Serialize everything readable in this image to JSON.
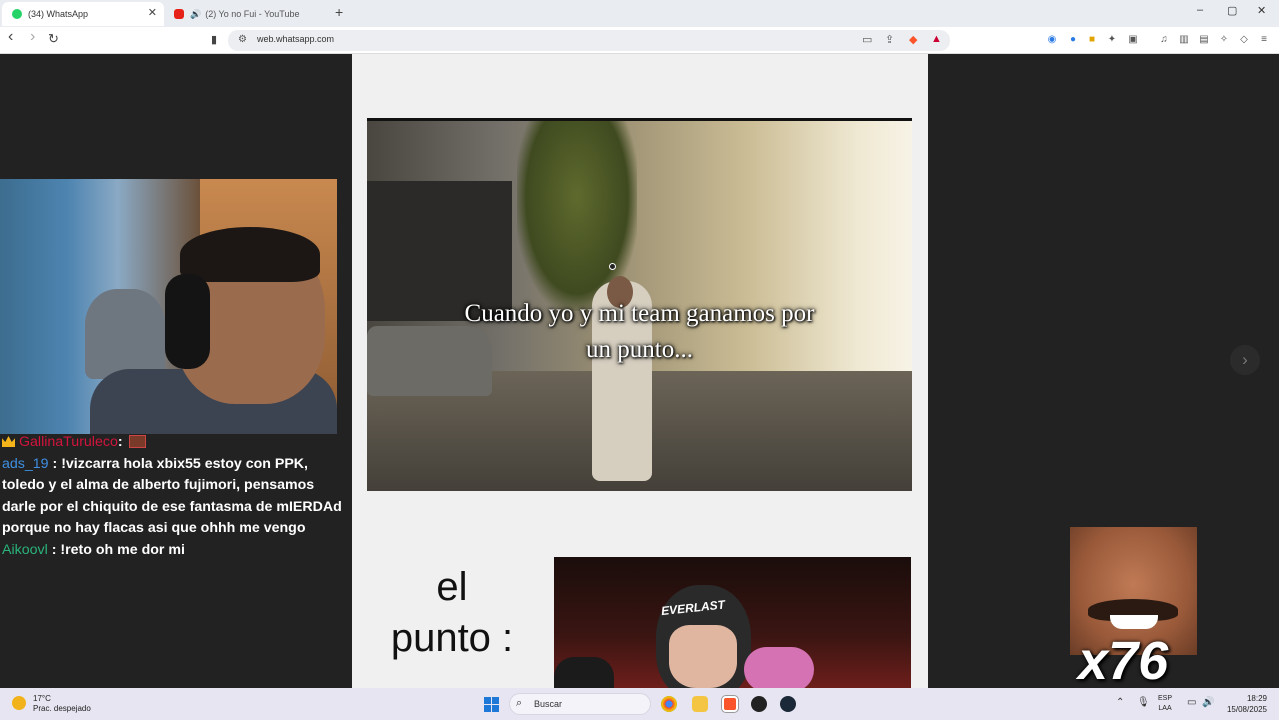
{
  "browser": {
    "tabs": [
      {
        "title": "(34) WhatsApp",
        "favicon": "whatsapp-icon",
        "active": true
      },
      {
        "title": "(2) Yo no Fui - YouTube",
        "favicon": "youtube-icon",
        "audio": "speaker-icon",
        "active": false
      }
    ],
    "new_tab": "+",
    "window_controls": {
      "minimize": "–",
      "restore": "▢",
      "close": "✕"
    },
    "nav": {
      "back": "‹",
      "forward": "›",
      "reload": "↻"
    },
    "url": "web.whatsapp.com"
  },
  "stream": {
    "chat": [
      {
        "user": "GallinaTuruleco",
        "color": "#d2143c",
        "badge": "crown-badge",
        "text": "",
        "emote": true
      },
      {
        "user": "ads_19",
        "color": "#3f8fe3",
        "text": "!vizcarra hola xbix55 estoy con PPK, toledo y el alma de alberto fujimori, pensamos darle por el chiquito de ese fantasma de mIERDAd porque no hay flacas asi que ohhh me vengo"
      },
      {
        "user": "Aikoovl",
        "color": "#29b37a",
        "text": "!reto oh me dor mi"
      }
    ],
    "separator": ":",
    "emote_counter": "x76"
  },
  "media": {
    "meme1_caption_line1": "Cuando yo y mi team ganamos por",
    "meme1_caption_line2": "un punto...",
    "meme2_line1": "el",
    "meme2_line2": "punto :",
    "meme2_helmet_text": "EVERLAST",
    "next_button": "›"
  },
  "taskbar": {
    "weather_temp": "17°C",
    "weather_desc": "Prac. despejado",
    "search_placeholder": "Buscar",
    "lang_line1": "ESP",
    "lang_line2": "LAA",
    "time": "18:29",
    "date": "15/08/2025"
  },
  "colors": {
    "tabstrip": "#e9ecf1",
    "dark_bg": "#222222",
    "viewer_bg": "#f0f0f0",
    "taskbar": "#e7e5f1"
  }
}
